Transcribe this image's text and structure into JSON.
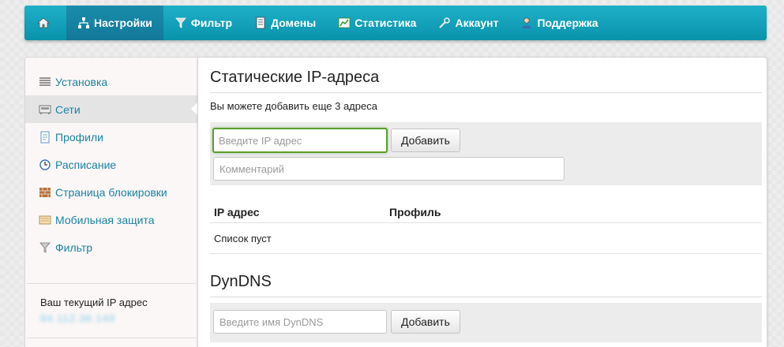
{
  "nav": {
    "items": [
      {
        "label": "Настройки",
        "icon": "network-icon",
        "active": true
      },
      {
        "label": "Фильтр",
        "icon": "filter-icon"
      },
      {
        "label": "Домены",
        "icon": "document-icon"
      },
      {
        "label": "Статистика",
        "icon": "chart-icon"
      },
      {
        "label": "Аккаунт",
        "icon": "wrench-icon"
      },
      {
        "label": "Поддержка",
        "icon": "support-user-icon"
      }
    ],
    "home_icon": "home-icon"
  },
  "sidebar": {
    "items": [
      {
        "label": "Установка",
        "icon": "list-icon"
      },
      {
        "label": "Сети",
        "icon": "network-card-icon",
        "active": true
      },
      {
        "label": "Профили",
        "icon": "profile-doc-icon"
      },
      {
        "label": "Расписание",
        "icon": "clock-icon"
      },
      {
        "label": "Страница блокировки",
        "icon": "brick-wall-icon"
      },
      {
        "label": "Мобильная защита",
        "icon": "mobile-shield-icon"
      },
      {
        "label": "Фильтр",
        "icon": "filter-icon"
      }
    ],
    "ip_label": "Ваш текущий IP адрес",
    "ip_value": "94.112.36.149"
  },
  "static_ip": {
    "title": "Статические IP-адреса",
    "hint": "Вы можете добавить еще 3 адреса",
    "ip_placeholder": "Введите IP адрес",
    "comment_placeholder": "Комментарий",
    "add_label": "Добавить",
    "table": {
      "columns": [
        "IP адрес",
        "Профиль"
      ],
      "empty_text": "Список пуст"
    }
  },
  "dyndns": {
    "title": "DynDNS",
    "placeholder": "Введите имя DynDNS",
    "add_label": "Добавить"
  },
  "colors": {
    "navbar": "#0fa0b9",
    "nav_active": "#13789a",
    "link": "#1a83a4",
    "focus_border": "#5aa02c"
  }
}
